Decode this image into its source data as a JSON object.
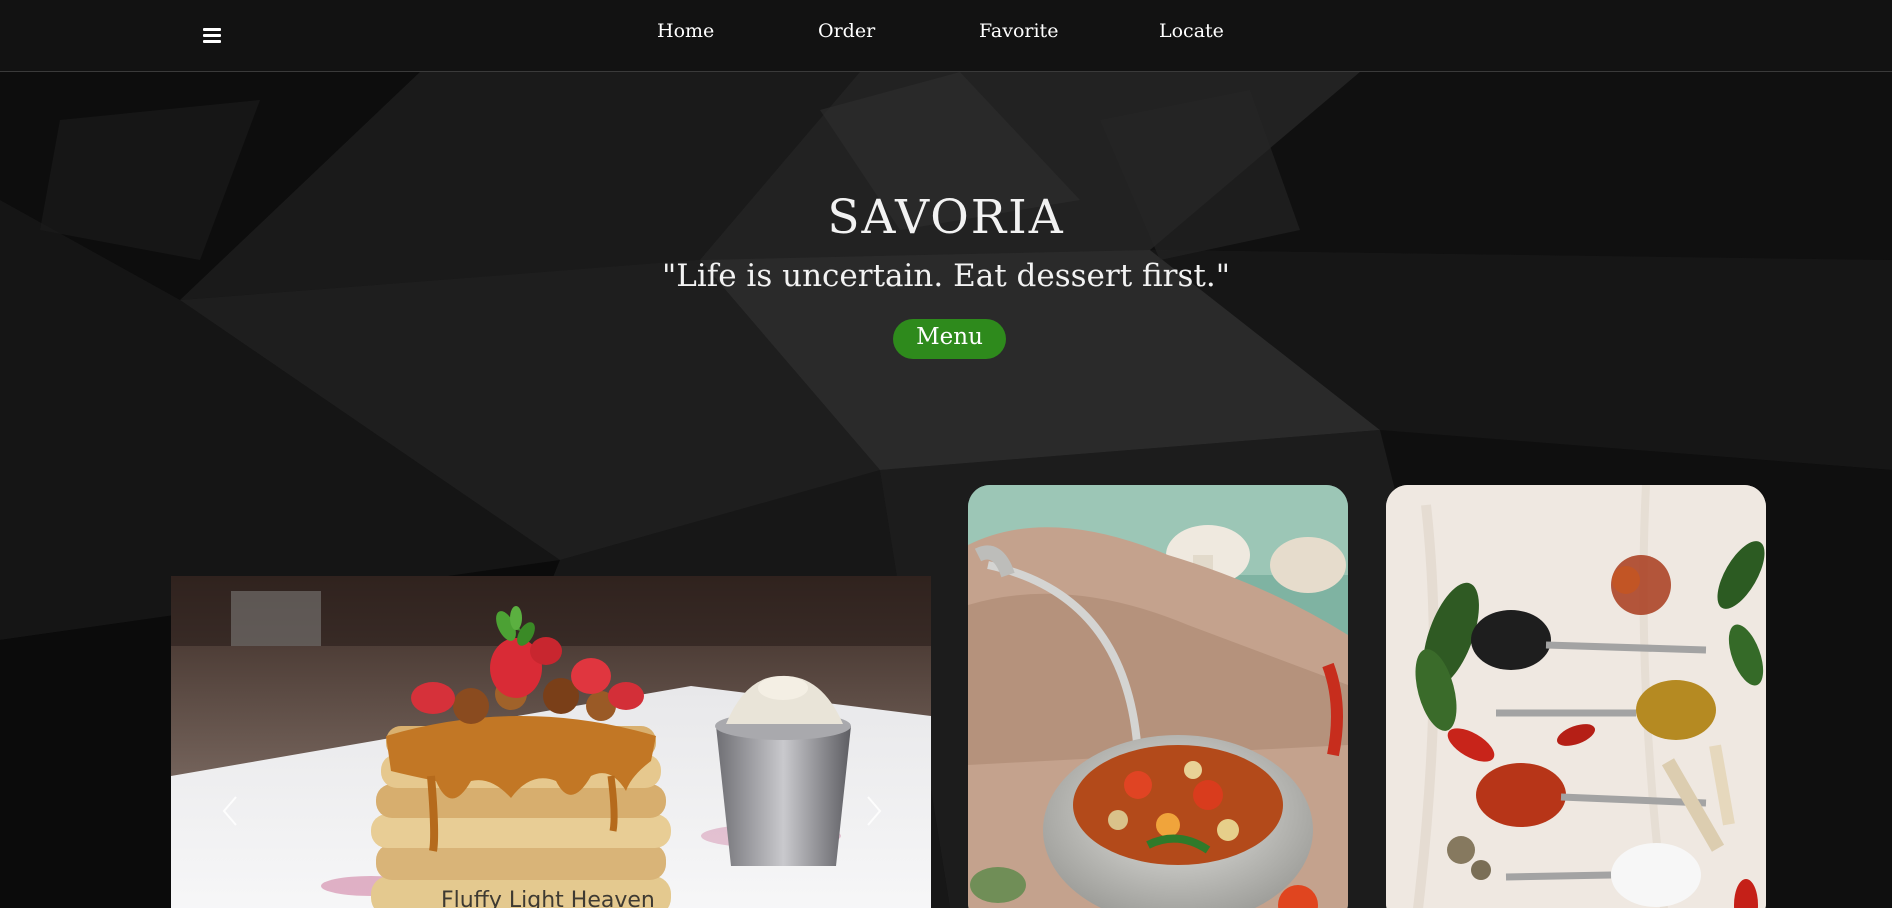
{
  "nav": {
    "menu_icon": "hamburger-icon",
    "links": [
      {
        "label": "Home"
      },
      {
        "label": "Order"
      },
      {
        "label": "Favorite"
      },
      {
        "label": "Locate"
      }
    ]
  },
  "hero": {
    "title": "SAVORIA",
    "quote": "\"Life is uncertain. Eat dessert first.\"",
    "button_label": "Menu"
  },
  "carousel": {
    "image": "pancake-stack-photo",
    "caption": "Fluffy Light Heaven",
    "prev_icon": "chevron-left-icon",
    "next_icon": "chevron-right-icon"
  },
  "cards": [
    {
      "image": "vegetable-soup-photo"
    },
    {
      "image": "spice-spoons-photo"
    }
  ],
  "colors": {
    "navbar": "#121212",
    "accent_button": "#2e8a1c",
    "text": "#f2f2f2"
  }
}
